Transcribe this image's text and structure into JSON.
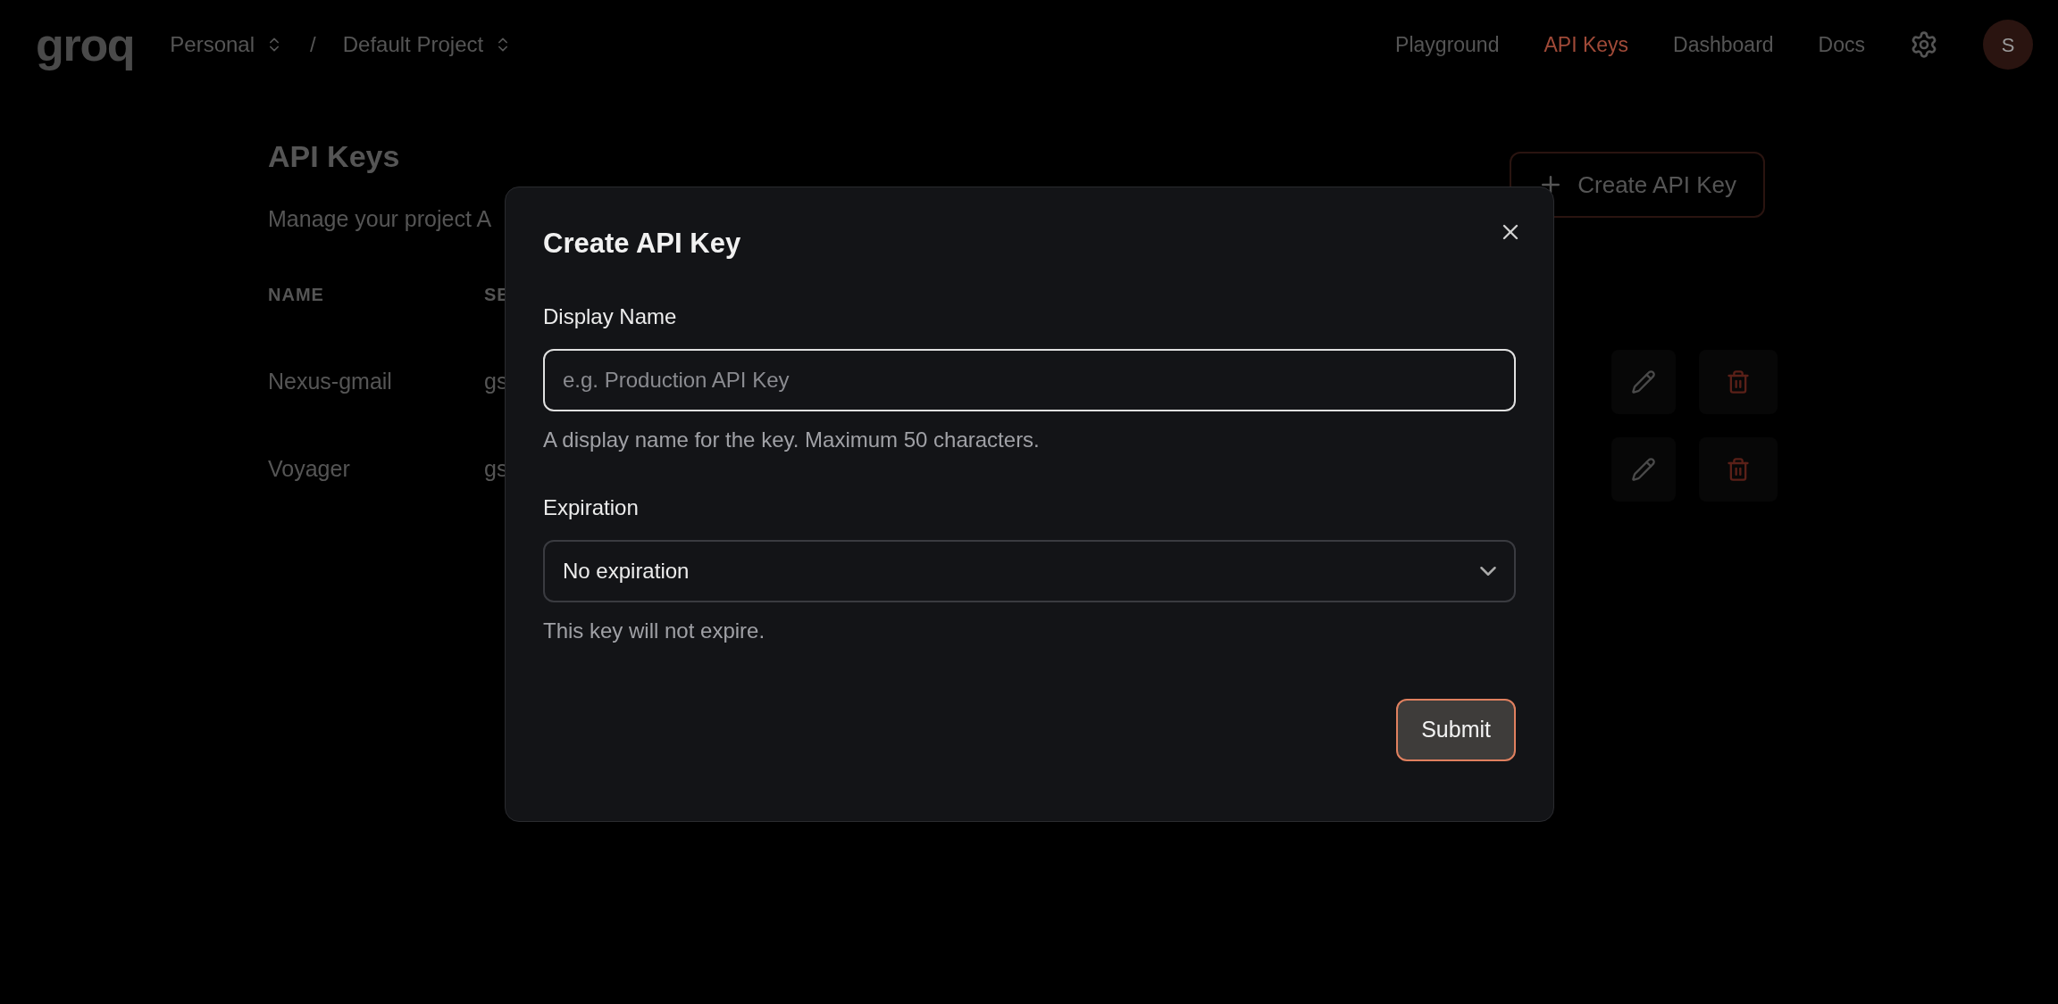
{
  "header": {
    "logo": "groq",
    "org": "Personal",
    "separator": "/",
    "project": "Default Project",
    "nav": [
      {
        "label": "Playground",
        "selected": false
      },
      {
        "label": "API Keys",
        "selected": true
      },
      {
        "label": "Dashboard",
        "selected": false
      },
      {
        "label": "Docs",
        "selected": false
      }
    ],
    "avatar": "S"
  },
  "page": {
    "title": "API Keys",
    "subtitle": "Manage your project A",
    "create_button": "Create API Key",
    "columns": [
      "NAME",
      "SE"
    ],
    "rows": [
      {
        "name": "Nexus-gmail",
        "column_2": "gs"
      },
      {
        "name": "Voyager",
        "column_2": "gs"
      }
    ]
  },
  "dialog": {
    "title": "Create API Key",
    "fields": [
      {
        "kind": "text",
        "label": "Display Name",
        "placeholder": "e.g. Production API Key",
        "hint": "A display name for the key. Maximum 50 characters.",
        "focused": true
      },
      {
        "kind": "select",
        "label": "Expiration",
        "value": "No expiration",
        "hint": "This key will not expire.",
        "focused": false
      }
    ],
    "submit": "Submit"
  }
}
